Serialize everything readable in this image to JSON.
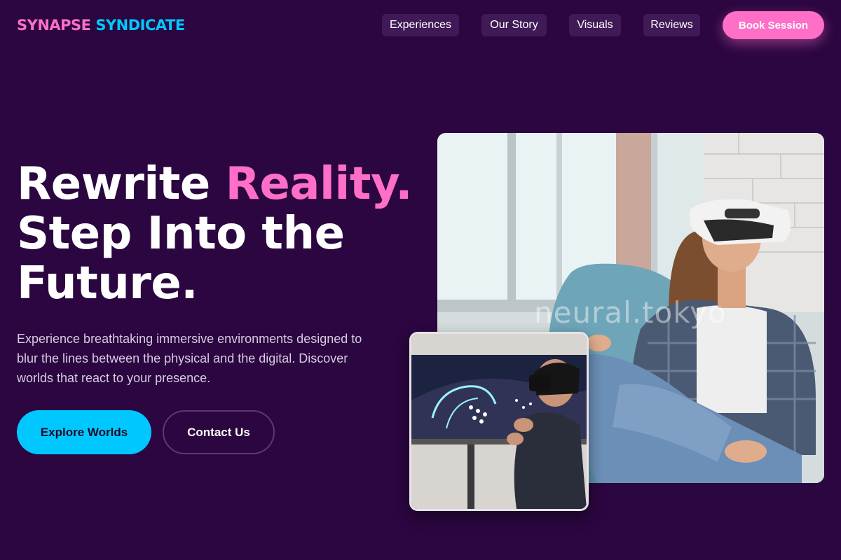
{
  "brand": {
    "part1": "SYNAPSE",
    "part2": "SYNDICATE"
  },
  "nav": {
    "links": [
      {
        "label": "Experiences"
      },
      {
        "label": "Our Story"
      },
      {
        "label": "Visuals"
      },
      {
        "label": "Reviews"
      }
    ],
    "cta_label": "Book Session"
  },
  "hero": {
    "headline_part1": "Rewrite ",
    "headline_accent": "Reality.",
    "headline_part2": "Step Into the Future.",
    "subtext": "Experience breathtaking immersive environments designed to blur the lines between the physical and the digital. Discover worlds that react to your presence.",
    "primary_button": "Explore Worlds",
    "secondary_button": "Contact Us"
  },
  "images": {
    "watermark": "neural.tokyo"
  },
  "colors": {
    "background": "#2b0640",
    "accent_pink": "#ff6ec7",
    "accent_cyan": "#00c8ff",
    "nav_pill": "#3f1a57"
  }
}
